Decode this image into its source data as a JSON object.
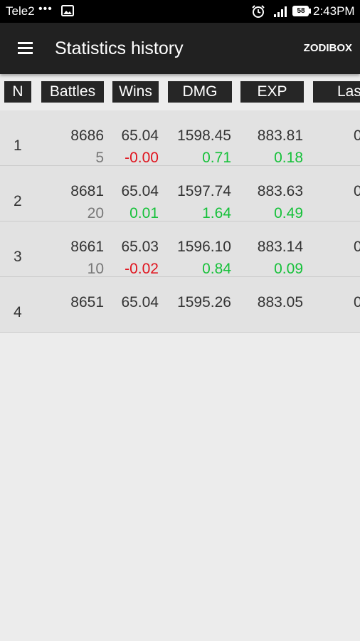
{
  "status_bar": {
    "carrier": "Tele2",
    "dots": "•••",
    "battery": "58",
    "time": "2:43PM"
  },
  "app_bar": {
    "title": "Statistics history",
    "action": "ZODIBOX"
  },
  "table": {
    "headers": [
      "N",
      "Battles",
      "Wins",
      "DMG",
      "EXP",
      "Las"
    ],
    "rows": [
      {
        "n": "1",
        "battles": "8686",
        "wins": "65.04",
        "dmg": "1598.45",
        "exp": "883.81",
        "last": "0",
        "d_battles": "5",
        "d_wins": "-0.00",
        "d_dmg": "0.71",
        "d_exp": "0.18"
      },
      {
        "n": "2",
        "battles": "8681",
        "wins": "65.04",
        "dmg": "1597.74",
        "exp": "883.63",
        "last": "0",
        "d_battles": "20",
        "d_wins": "0.01",
        "d_dmg": "1.64",
        "d_exp": "0.49"
      },
      {
        "n": "3",
        "battles": "8661",
        "wins": "65.03",
        "dmg": "1596.10",
        "exp": "883.14",
        "last": "0",
        "d_battles": "10",
        "d_wins": "-0.02",
        "d_dmg": "0.84",
        "d_exp": "0.09"
      },
      {
        "n": "4",
        "battles": "8651",
        "wins": "65.04",
        "dmg": "1595.26",
        "exp": "883.05",
        "last": "0"
      }
    ]
  },
  "colors": {
    "negative": "#e0141e",
    "positive": "#16c13a",
    "header_bg": "#262626",
    "app_bar_bg": "#212121"
  }
}
